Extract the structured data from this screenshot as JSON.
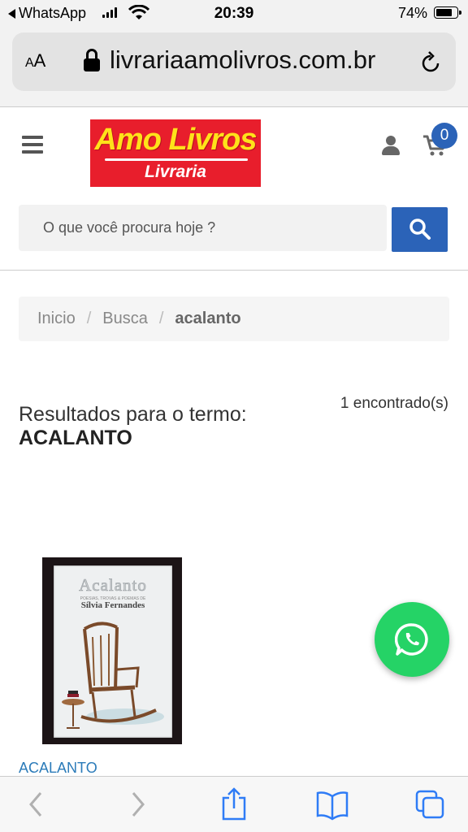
{
  "status_bar": {
    "back_app": "WhatsApp",
    "time": "20:39",
    "battery": "74%"
  },
  "browser": {
    "text_size_label": "AA",
    "url": "livrariaamolivros.com.br"
  },
  "header": {
    "logo_main": "Amo Livros",
    "logo_sub": "Livraria",
    "cart_count": "0",
    "search_placeholder": "O que você procura hoje ?",
    "brand_color": "#2b63b8",
    "logo_bg": "#e81e2c"
  },
  "breadcrumb": {
    "items": [
      "Inicio",
      "Busca",
      "acalanto"
    ],
    "separator": "/"
  },
  "results": {
    "label": "Resultados para o termo:",
    "term": "ACALANTO",
    "count": "1 encontrado(s)"
  },
  "products": [
    {
      "name": "ACALANTO",
      "cover_title": "Acalanto",
      "cover_subtitle": "POESIAS, TROVAS & POEMAS DE",
      "cover_author": "Sílvia Fernandes"
    }
  ],
  "icons": {
    "menu": "hamburger-icon",
    "user": "user-icon",
    "cart": "cart-icon",
    "search": "search-icon",
    "whatsapp": "whatsapp-icon",
    "toolbar": [
      "back-icon",
      "forward-icon",
      "share-icon",
      "bookmarks-icon",
      "tabs-icon"
    ]
  }
}
